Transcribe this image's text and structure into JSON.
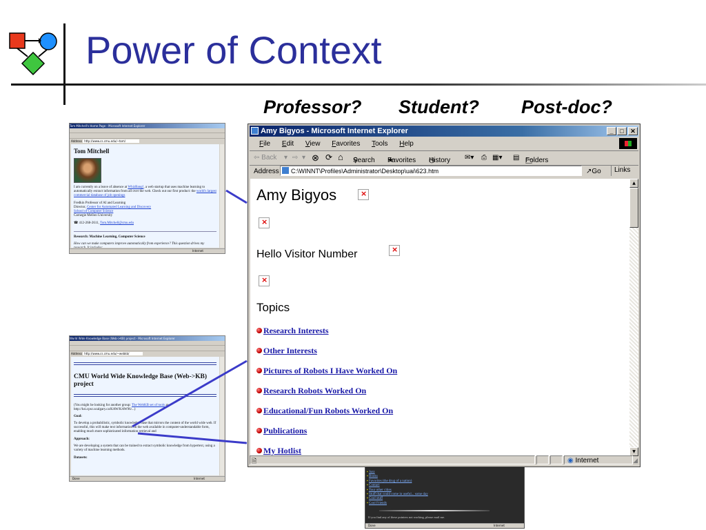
{
  "slide": {
    "title": "Power of Context",
    "questions": [
      "Professor?",
      "Student?",
      "Post-doc?"
    ]
  },
  "tom_window": {
    "title": "Tom Mitchell's Home Page - Microsoft Internet Explorer",
    "address": "http://www.cs.cmu.edu/~tom/",
    "name": "Tom Mitchell",
    "para1": "I am currently on a leave of absence at",
    "link1": "WhizBang!",
    "para1b": ", a web startup that uses machine learning to automatically extract information from all over the web. Check out our first product: the",
    "link2": "world's largest commercial database of job openings",
    "title_line": "Fredkin Professor of AI and Learning",
    "director": "Director,",
    "link3": "Center for Automated Learning and Discovery",
    "link4": "School of Computer Science",
    "cmu": "Carnegie Mellon University",
    "phone": "412-268-2611,",
    "email": "Tom.Mitchell@cmu.edu",
    "research": "Research: Machine Learning, Computer Science",
    "research_q": "How can we make computers improve automatically from experience? This question drives my research. It includes:",
    "status": "Internet"
  },
  "kb_window": {
    "title": "World Wide Knowledge Base (Web->KB) project - Microsoft Internet Explorer",
    "address": "http://www.cs.cmu.edu/~webkb/",
    "heading": "CMU World Wide Knowledge Base (Web->KB) project",
    "lookfor": "(You might be looking for another group:",
    "lookfor_link": "The WebKB set of tools",
    "lookfor_end": "at http://ksi.cpsc.ucalgary.ca/KAW/KAW96/...)",
    "goal_label": "Goal:",
    "goal": "To develop a probabilistic, symbolic knowledge base that mirrors the content of the world wide web. If successful, this will make text information on the web available in computer-understandable form, enabling much more sophisticated information retrieval and",
    "approach_label": "Approach:",
    "approach": "We are developing a system that can be trained to extract symbolic knowledge from hypertext, using a variety of machine learning methods.",
    "datasets_label": "Datasets:",
    "status_left": "Done",
    "status": "Internet"
  },
  "dark_window": {
    "links": [
      "Jazz",
      "Books",
      "Favorites (the drug of a nation)",
      "Contact",
      "Tour other cities",
      "Stuff that could come in useful... some day",
      "Cool stuff",
      "Cool Friends"
    ],
    "footer": "If you find any of these pointers not working, please mail me.",
    "status_left": "Done",
    "status": "Internet"
  },
  "ie": {
    "title": "Amy Bigyos - Microsoft Internet Explorer",
    "menu": [
      "File",
      "Edit",
      "View",
      "Favorites",
      "Tools",
      "Help"
    ],
    "toolbar": {
      "back": "⇦ Back",
      "forward": "⇨",
      "search": "Search",
      "favorites": "Favorites",
      "history": "History",
      "folders": "Folders"
    },
    "address_label": "Address",
    "address": "C:\\WINNT\\Profiles\\Administrator\\Desktop\\uai\\623.htm",
    "go": "Go",
    "links": "Links",
    "links_more": "»",
    "page": {
      "heading": "Amy Bigyos",
      "visitor": "Hello Visitor Number",
      "topics_heading": "Topics",
      "topics": [
        "Research Interests",
        "Other Interests",
        "Pictures of Robots I Have Worked On",
        "Research Robots Worked On",
        "Educational/Fun Robots Worked On",
        "Publications",
        "My Hotlist"
      ]
    },
    "status": "Internet"
  },
  "colors": {
    "title_blue": "#2b2f9b",
    "callout": "#3b3bc9",
    "link_blue": "#1a1aa8"
  }
}
